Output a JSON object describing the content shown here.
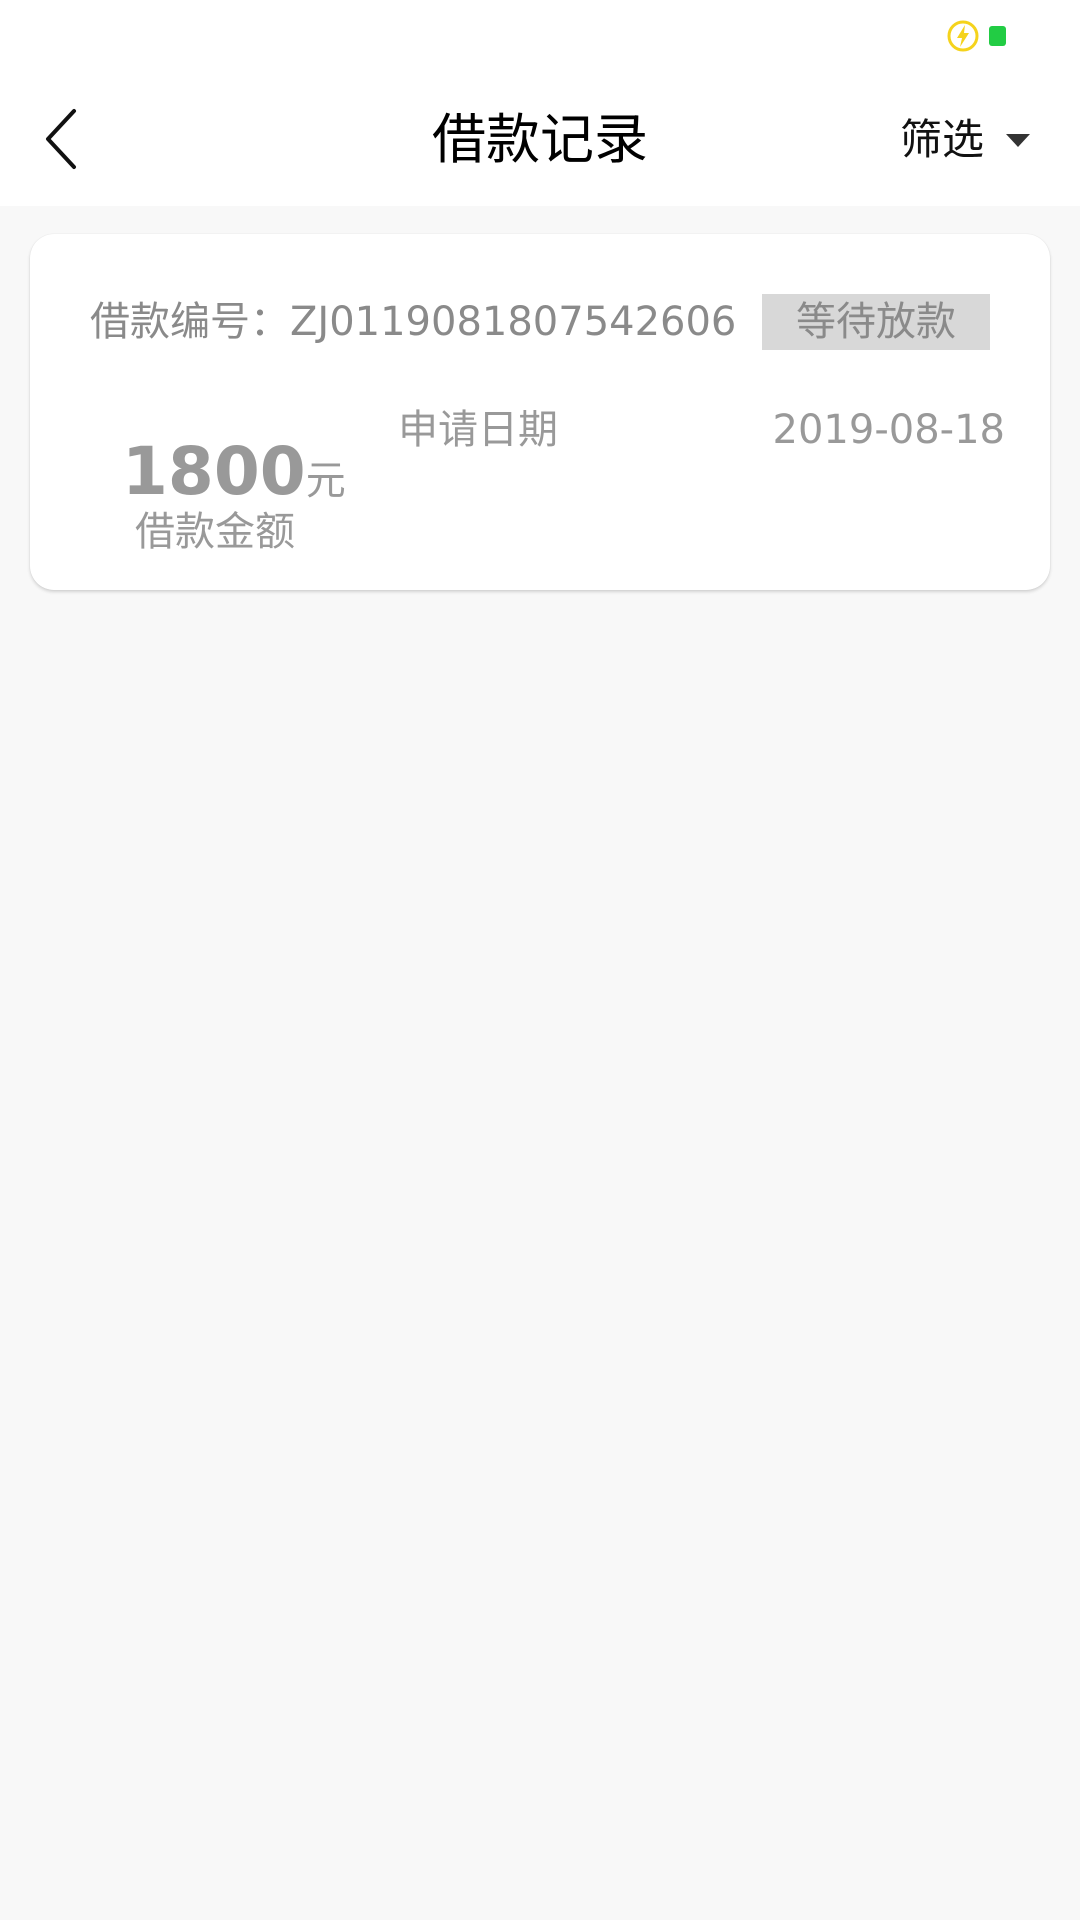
{
  "colors": {
    "background": "#f8f8f8",
    "card": "#ffffff",
    "muted_text": "#8a8a8a",
    "badge_bg": "#d8d8d8",
    "battery": "#22cc44",
    "charge_icon": "#f5d31c"
  },
  "statusbar": {
    "icons": [
      "charging-icon",
      "battery-icon"
    ]
  },
  "header": {
    "title": "借款记录",
    "back_icon": "chevron-left-icon",
    "filter_label": "筛选",
    "filter_icon": "caret-down-icon"
  },
  "records": [
    {
      "loan_no_text": "借款编号：ZJ0119081807542606",
      "status": "等待放款",
      "amount": "1800",
      "amount_unit": "元",
      "amount_label": "借款金额",
      "apply_label": "申请日期",
      "apply_date": "2019-08-18"
    }
  ]
}
